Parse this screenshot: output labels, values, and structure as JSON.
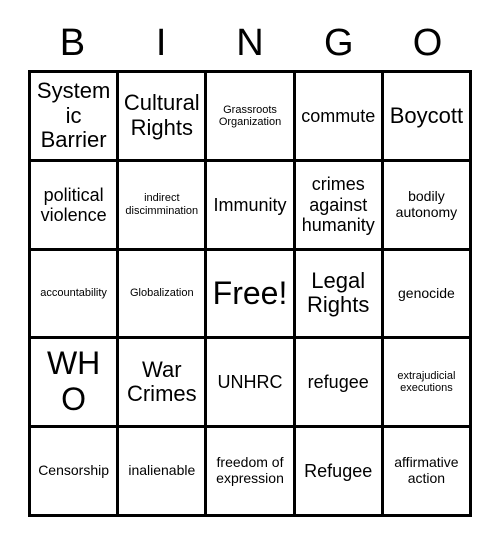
{
  "card": {
    "header_letters": [
      "B",
      "I",
      "N",
      "G",
      "O"
    ],
    "grid": {
      "rows": [
        [
          {
            "text": "Systemic Barrier",
            "size": "lg"
          },
          {
            "text": "Cultural Rights",
            "size": "lg"
          },
          {
            "text": "Grassroots Organization",
            "size": "xs"
          },
          {
            "text": "commute",
            "size": "md"
          },
          {
            "text": "Boycott",
            "size": "lg"
          }
        ],
        [
          {
            "text": "political violence",
            "size": "md"
          },
          {
            "text": "indirect discimmination",
            "size": "xs"
          },
          {
            "text": "Immunity",
            "size": "md"
          },
          {
            "text": "crimes against humanity",
            "size": "md"
          },
          {
            "text": "bodily autonomy",
            "size": "sm"
          }
        ],
        [
          {
            "text": "accountability",
            "size": "xs"
          },
          {
            "text": "Globalization",
            "size": "xs"
          },
          {
            "text": "Free!",
            "size": "xl"
          },
          {
            "text": "Legal Rights",
            "size": "lg"
          },
          {
            "text": "genocide",
            "size": "sm"
          }
        ],
        [
          {
            "text": "WHO",
            "size": "xl"
          },
          {
            "text": "War Crimes",
            "size": "lg"
          },
          {
            "text": "UNHRC",
            "size": "md"
          },
          {
            "text": "refugee",
            "size": "md"
          },
          {
            "text": "extrajudicial executions",
            "size": "xs"
          }
        ],
        [
          {
            "text": "Censorship",
            "size": "sm"
          },
          {
            "text": "inalienable",
            "size": "sm"
          },
          {
            "text": "freedom of expression",
            "size": "sm"
          },
          {
            "text": "Refugee",
            "size": "md"
          },
          {
            "text": "affirmative action",
            "size": "sm"
          }
        ]
      ]
    },
    "colors": {
      "ink": "#000000",
      "background": "#ffffff",
      "border": "#000000"
    }
  }
}
